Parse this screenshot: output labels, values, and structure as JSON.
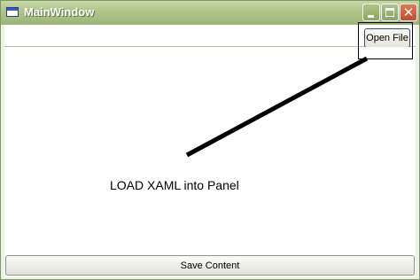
{
  "window": {
    "title": "MainWindow",
    "icon": "window-app-icon",
    "controls": {
      "minimize_icon": "minimize-icon",
      "maximize_icon": "maximize-icon",
      "close_icon": "close-icon",
      "close_glyph": "✕"
    },
    "accent_color": "#9db477",
    "close_color": "#c34a2a"
  },
  "toolbar": {
    "open_file_label": "Open File"
  },
  "panel": {
    "label": "LOAD XAML into Panel"
  },
  "footer": {
    "save_label": "Save Content"
  }
}
